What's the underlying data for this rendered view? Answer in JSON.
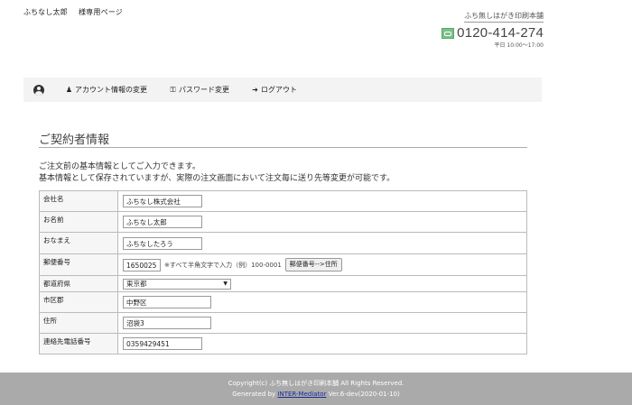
{
  "header": {
    "user_name": "ふちなし太郎",
    "page_label": "様専用ページ",
    "brand": "ふち無しはがき印刷本舗",
    "phone": "0120-414-274",
    "hours": "平日 10:00～17:00"
  },
  "nav": {
    "items": [
      {
        "label": "アカウント情報の変更"
      },
      {
        "label": "パスワード変更"
      },
      {
        "label": "ログアウト"
      }
    ]
  },
  "main": {
    "title": "ご契約者情報",
    "desc1": "ご注文前の基本情報としてご入力できます。",
    "desc2": "基本情報として保存されていますが、実際の注文画面において注文毎に送り先等変更が可能です。"
  },
  "form": {
    "company": {
      "label": "会社名",
      "value": "ふちなし株式会社"
    },
    "name": {
      "label": "お名前",
      "value": "ふちなし太郎"
    },
    "kana": {
      "label": "おなまえ",
      "value": "ふちなしたろう"
    },
    "postal": {
      "label": "郵便番号",
      "value": "1650025",
      "note": "※すべて半角文字で入力（例）100-0001",
      "button": "郵便番号-->住所"
    },
    "prefecture": {
      "label": "都道府県",
      "value": "東京都"
    },
    "city": {
      "label": "市区郡",
      "value": "中野区"
    },
    "address": {
      "label": "住所",
      "value": "沼袋3"
    },
    "tel": {
      "label": "連絡先電話番号",
      "value": "0359429451"
    }
  },
  "footer": {
    "copyright": "Copyright(c) ふち無しはがき印刷本舗 All Rights Reserved.",
    "generated_prefix": "Generated by",
    "link": "INTER-Mediator",
    "version": "Ver.6-dev(2020-01-10)"
  },
  "colors": {
    "nav_bg": "#f3f3f3",
    "footer_bg": "#aaaaaa",
    "link": "#1a2a9a",
    "freedial": "#7ac08a"
  }
}
